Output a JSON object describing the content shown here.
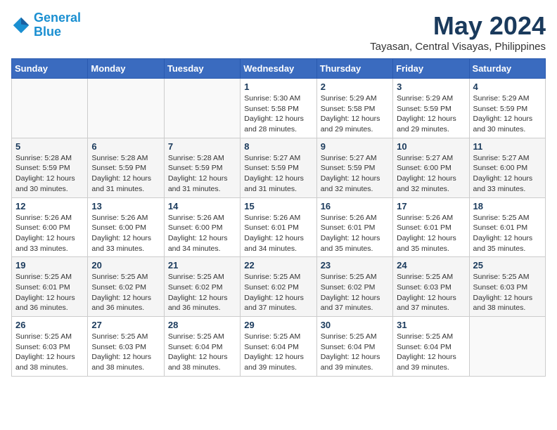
{
  "header": {
    "logo_line1": "General",
    "logo_line2": "Blue",
    "month": "May 2024",
    "location": "Tayasan, Central Visayas, Philippines"
  },
  "weekdays": [
    "Sunday",
    "Monday",
    "Tuesday",
    "Wednesday",
    "Thursday",
    "Friday",
    "Saturday"
  ],
  "weeks": [
    [
      {
        "day": "",
        "sunrise": "",
        "sunset": "",
        "daylight": ""
      },
      {
        "day": "",
        "sunrise": "",
        "sunset": "",
        "daylight": ""
      },
      {
        "day": "",
        "sunrise": "",
        "sunset": "",
        "daylight": ""
      },
      {
        "day": "1",
        "sunrise": "Sunrise: 5:30 AM",
        "sunset": "Sunset: 5:58 PM",
        "daylight": "Daylight: 12 hours and 28 minutes."
      },
      {
        "day": "2",
        "sunrise": "Sunrise: 5:29 AM",
        "sunset": "Sunset: 5:58 PM",
        "daylight": "Daylight: 12 hours and 29 minutes."
      },
      {
        "day": "3",
        "sunrise": "Sunrise: 5:29 AM",
        "sunset": "Sunset: 5:59 PM",
        "daylight": "Daylight: 12 hours and 29 minutes."
      },
      {
        "day": "4",
        "sunrise": "Sunrise: 5:29 AM",
        "sunset": "Sunset: 5:59 PM",
        "daylight": "Daylight: 12 hours and 30 minutes."
      }
    ],
    [
      {
        "day": "5",
        "sunrise": "Sunrise: 5:28 AM",
        "sunset": "Sunset: 5:59 PM",
        "daylight": "Daylight: 12 hours and 30 minutes."
      },
      {
        "day": "6",
        "sunrise": "Sunrise: 5:28 AM",
        "sunset": "Sunset: 5:59 PM",
        "daylight": "Daylight: 12 hours and 31 minutes."
      },
      {
        "day": "7",
        "sunrise": "Sunrise: 5:28 AM",
        "sunset": "Sunset: 5:59 PM",
        "daylight": "Daylight: 12 hours and 31 minutes."
      },
      {
        "day": "8",
        "sunrise": "Sunrise: 5:27 AM",
        "sunset": "Sunset: 5:59 PM",
        "daylight": "Daylight: 12 hours and 31 minutes."
      },
      {
        "day": "9",
        "sunrise": "Sunrise: 5:27 AM",
        "sunset": "Sunset: 5:59 PM",
        "daylight": "Daylight: 12 hours and 32 minutes."
      },
      {
        "day": "10",
        "sunrise": "Sunrise: 5:27 AM",
        "sunset": "Sunset: 6:00 PM",
        "daylight": "Daylight: 12 hours and 32 minutes."
      },
      {
        "day": "11",
        "sunrise": "Sunrise: 5:27 AM",
        "sunset": "Sunset: 6:00 PM",
        "daylight": "Daylight: 12 hours and 33 minutes."
      }
    ],
    [
      {
        "day": "12",
        "sunrise": "Sunrise: 5:26 AM",
        "sunset": "Sunset: 6:00 PM",
        "daylight": "Daylight: 12 hours and 33 minutes."
      },
      {
        "day": "13",
        "sunrise": "Sunrise: 5:26 AM",
        "sunset": "Sunset: 6:00 PM",
        "daylight": "Daylight: 12 hours and 33 minutes."
      },
      {
        "day": "14",
        "sunrise": "Sunrise: 5:26 AM",
        "sunset": "Sunset: 6:00 PM",
        "daylight": "Daylight: 12 hours and 34 minutes."
      },
      {
        "day": "15",
        "sunrise": "Sunrise: 5:26 AM",
        "sunset": "Sunset: 6:01 PM",
        "daylight": "Daylight: 12 hours and 34 minutes."
      },
      {
        "day": "16",
        "sunrise": "Sunrise: 5:26 AM",
        "sunset": "Sunset: 6:01 PM",
        "daylight": "Daylight: 12 hours and 35 minutes."
      },
      {
        "day": "17",
        "sunrise": "Sunrise: 5:26 AM",
        "sunset": "Sunset: 6:01 PM",
        "daylight": "Daylight: 12 hours and 35 minutes."
      },
      {
        "day": "18",
        "sunrise": "Sunrise: 5:25 AM",
        "sunset": "Sunset: 6:01 PM",
        "daylight": "Daylight: 12 hours and 35 minutes."
      }
    ],
    [
      {
        "day": "19",
        "sunrise": "Sunrise: 5:25 AM",
        "sunset": "Sunset: 6:01 PM",
        "daylight": "Daylight: 12 hours and 36 minutes."
      },
      {
        "day": "20",
        "sunrise": "Sunrise: 5:25 AM",
        "sunset": "Sunset: 6:02 PM",
        "daylight": "Daylight: 12 hours and 36 minutes."
      },
      {
        "day": "21",
        "sunrise": "Sunrise: 5:25 AM",
        "sunset": "Sunset: 6:02 PM",
        "daylight": "Daylight: 12 hours and 36 minutes."
      },
      {
        "day": "22",
        "sunrise": "Sunrise: 5:25 AM",
        "sunset": "Sunset: 6:02 PM",
        "daylight": "Daylight: 12 hours and 37 minutes."
      },
      {
        "day": "23",
        "sunrise": "Sunrise: 5:25 AM",
        "sunset": "Sunset: 6:02 PM",
        "daylight": "Daylight: 12 hours and 37 minutes."
      },
      {
        "day": "24",
        "sunrise": "Sunrise: 5:25 AM",
        "sunset": "Sunset: 6:03 PM",
        "daylight": "Daylight: 12 hours and 37 minutes."
      },
      {
        "day": "25",
        "sunrise": "Sunrise: 5:25 AM",
        "sunset": "Sunset: 6:03 PM",
        "daylight": "Daylight: 12 hours and 38 minutes."
      }
    ],
    [
      {
        "day": "26",
        "sunrise": "Sunrise: 5:25 AM",
        "sunset": "Sunset: 6:03 PM",
        "daylight": "Daylight: 12 hours and 38 minutes."
      },
      {
        "day": "27",
        "sunrise": "Sunrise: 5:25 AM",
        "sunset": "Sunset: 6:03 PM",
        "daylight": "Daylight: 12 hours and 38 minutes."
      },
      {
        "day": "28",
        "sunrise": "Sunrise: 5:25 AM",
        "sunset": "Sunset: 6:04 PM",
        "daylight": "Daylight: 12 hours and 38 minutes."
      },
      {
        "day": "29",
        "sunrise": "Sunrise: 5:25 AM",
        "sunset": "Sunset: 6:04 PM",
        "daylight": "Daylight: 12 hours and 39 minutes."
      },
      {
        "day": "30",
        "sunrise": "Sunrise: 5:25 AM",
        "sunset": "Sunset: 6:04 PM",
        "daylight": "Daylight: 12 hours and 39 minutes."
      },
      {
        "day": "31",
        "sunrise": "Sunrise: 5:25 AM",
        "sunset": "Sunset: 6:04 PM",
        "daylight": "Daylight: 12 hours and 39 minutes."
      },
      {
        "day": "",
        "sunrise": "",
        "sunset": "",
        "daylight": ""
      }
    ]
  ]
}
